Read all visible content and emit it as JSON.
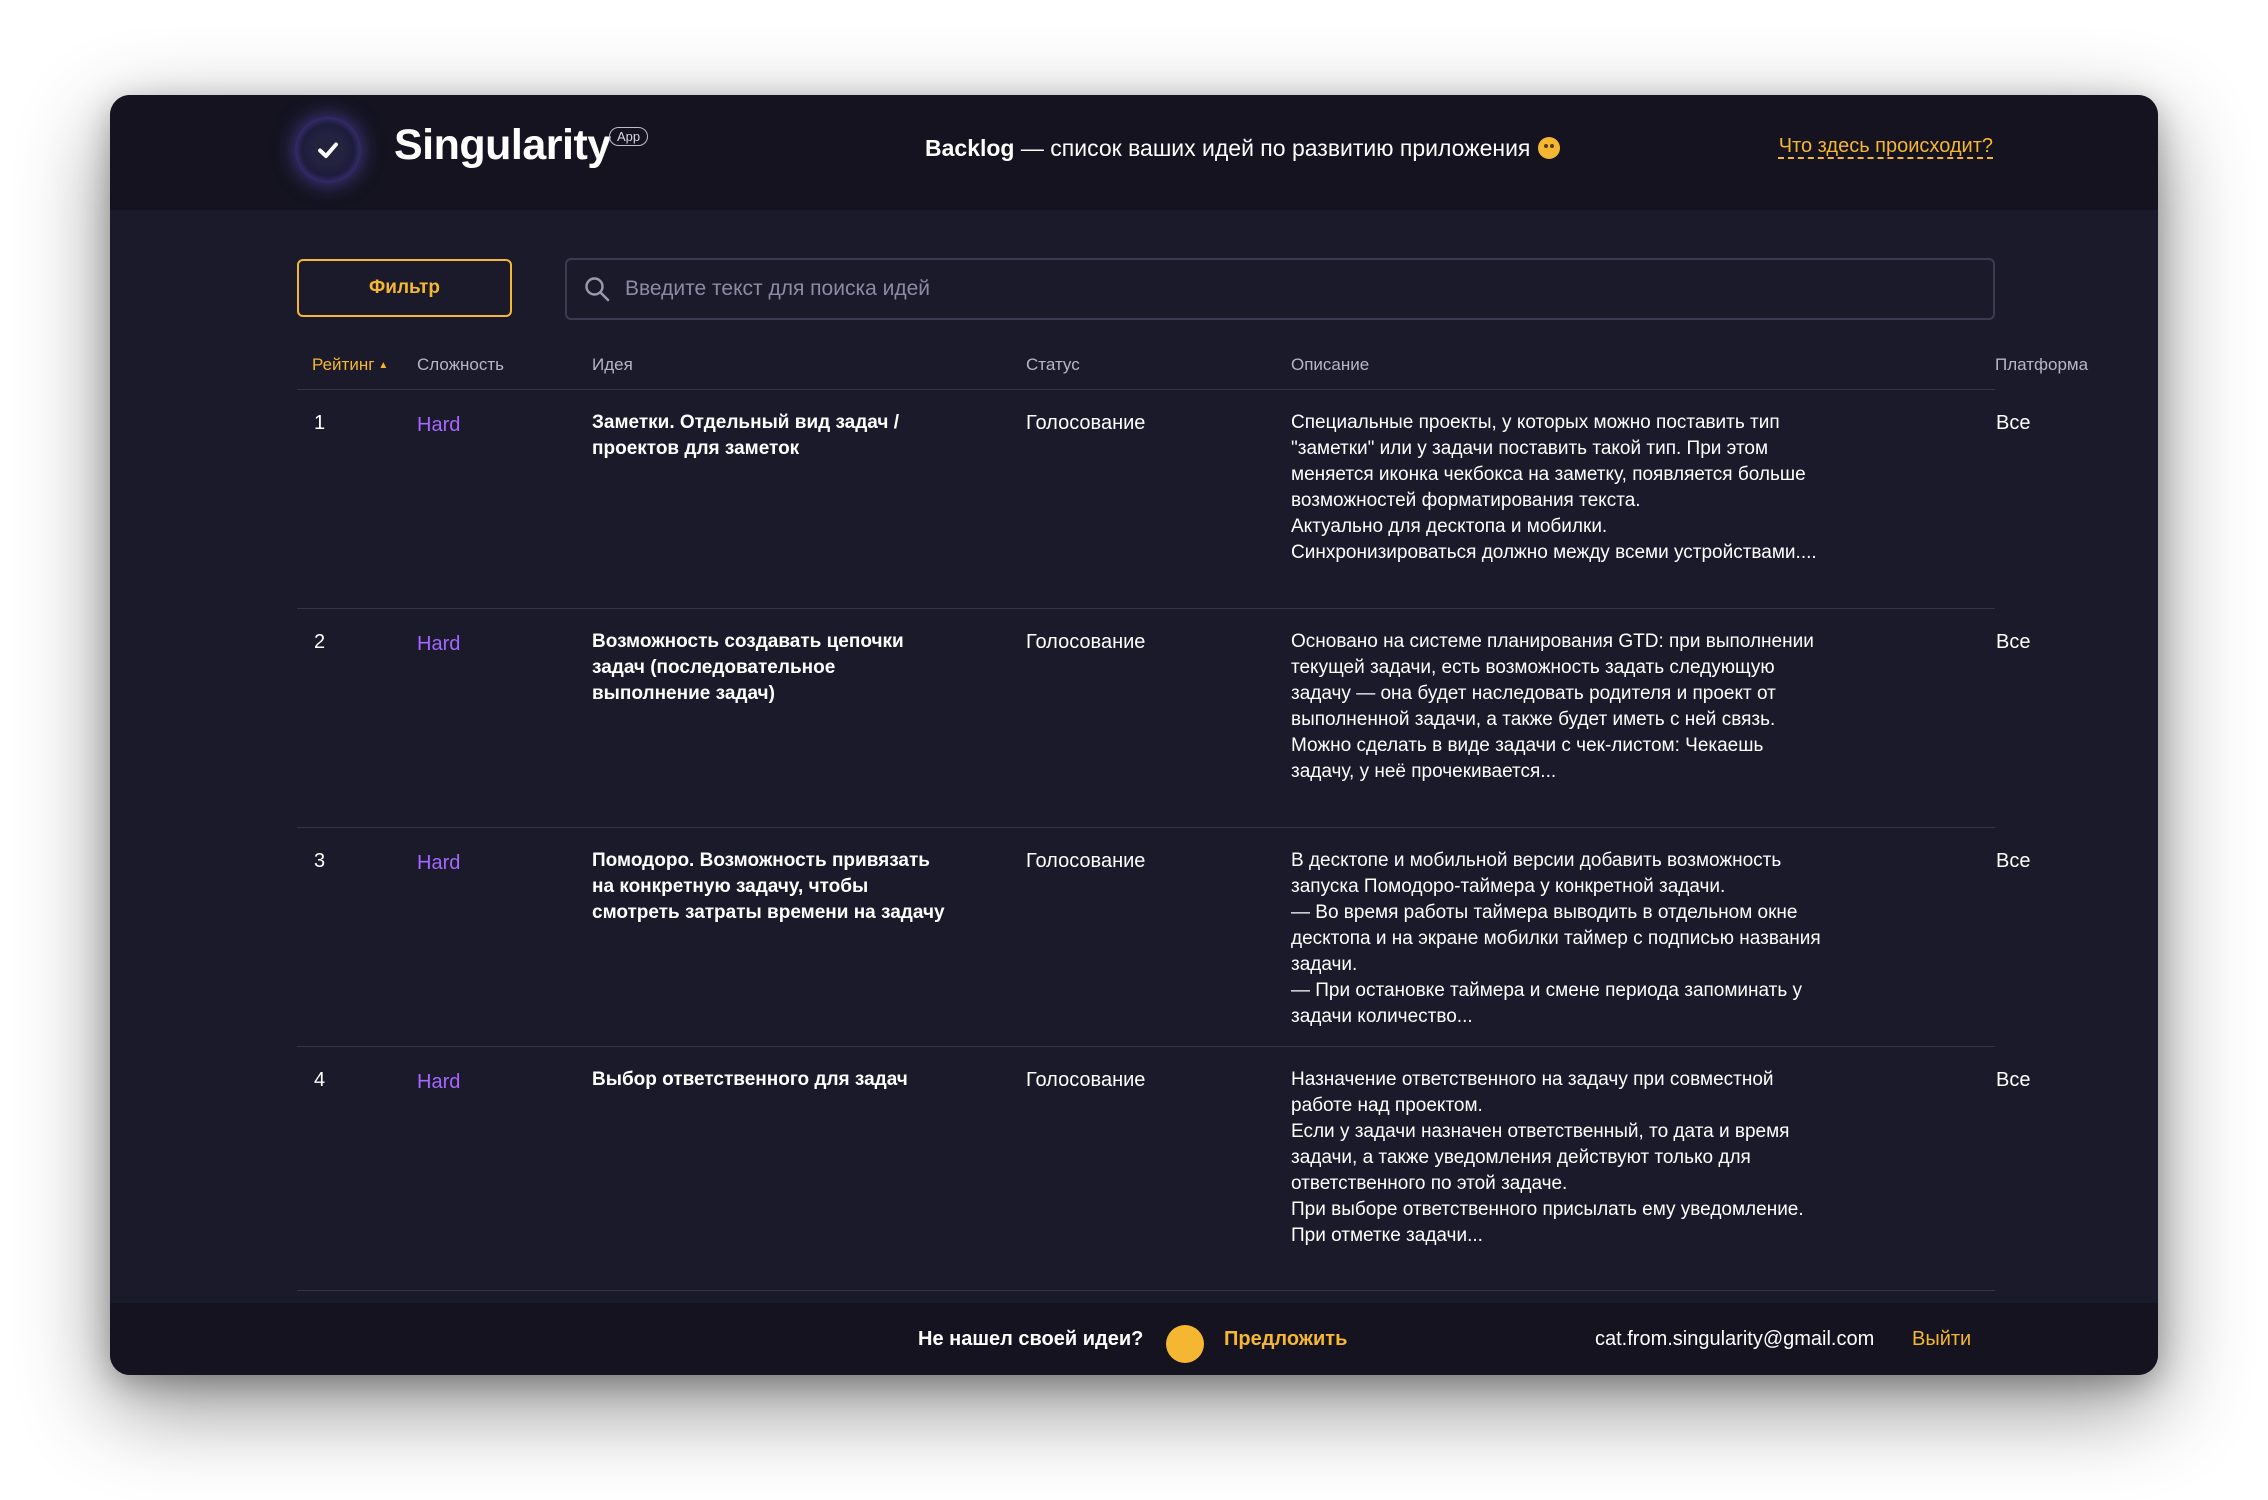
{
  "header": {
    "brand": "Singularity",
    "badge": "App",
    "title_bold": "Backlog",
    "title_rest": " — список ваших идей по развитию приложения",
    "help_link": "Что здесь происходит?"
  },
  "toolbar": {
    "filter_label": "Фильтр",
    "search_placeholder": "Введите текст для поиска идей"
  },
  "table": {
    "columns": {
      "rating": "Рейтинг",
      "difficulty": "Сложность",
      "idea": "Идея",
      "status": "Статус",
      "description": "Описание",
      "platform": "Платформа"
    },
    "rows": [
      {
        "rating": "1",
        "difficulty": "Hard",
        "idea": "Заметки. Отдельный вид задач / проектов для заметок",
        "status": "Голосование",
        "description": "Специальные проекты, у которых можно поставить тип \"заметки\" или у задачи поставить такой тип. При этом меняется иконка чекбокса на заметку, появляется больше возможностей форматирования текста.\nАктуально для десктопа и мобилки.\nСинхронизироваться должно между всеми устройствами....",
        "platform": "Все"
      },
      {
        "rating": "2",
        "difficulty": "Hard",
        "idea": "Возможность создавать цепочки задач (последовательное выполнение задач)",
        "status": "Голосование",
        "description": "Основано на системе планирования GTD: при выполнении текущей задачи, есть возможность задать следующую задачу — она будет наследовать родителя и проект от выполненной задачи, а также будет иметь с ней связь.\nМожно сделать в виде задачи с чек-листом: Чекаешь задачу, у неё прочекивается...",
        "platform": "Все"
      },
      {
        "rating": "3",
        "difficulty": "Hard",
        "idea": "Помодоро. Возможность привязать на конкретную задачу, чтобы смотреть затраты времени на задачу",
        "status": "Голосование",
        "description": "В десктопе и мобильной версии добавить возможность запуска Помодоро-таймера у конкретной задачи.\n— Во время работы таймера выводить в отдельном окне десктопа и на экране мобилки таймер с подписью названия задачи.\n— При остановке таймера и смене периода запоминать у задачи количество...",
        "platform": "Все"
      },
      {
        "rating": "4",
        "difficulty": "Hard",
        "idea": "Выбор ответственного для задач",
        "status": "Голосование",
        "description": "Назначение ответственного на задачу при совместной работе над проектом.\nЕсли у задачи назначен ответственный, то дата и время задачи, а также уведомления действуют только для ответственного по этой задаче.\nПри выборе ответственного присылать ему уведомление.\nПри отметке задачи...",
        "platform": "Все"
      }
    ]
  },
  "footer": {
    "question": "Не нашел своей идеи?",
    "suggest": "Предложить",
    "email": "cat.from.singularity@gmail.com",
    "logout": "Выйти"
  },
  "colors": {
    "accent": "#f5b731",
    "difficulty_hard": "#a467ff",
    "background": "#1b1a2b",
    "header_bg": "#14131f"
  },
  "icons": {
    "logo": "check-circle-icon",
    "search": "search-icon",
    "sort": "sort-asc-icon",
    "emoji": "smiling-emoji-icon",
    "footer_dot": "circle-icon"
  }
}
